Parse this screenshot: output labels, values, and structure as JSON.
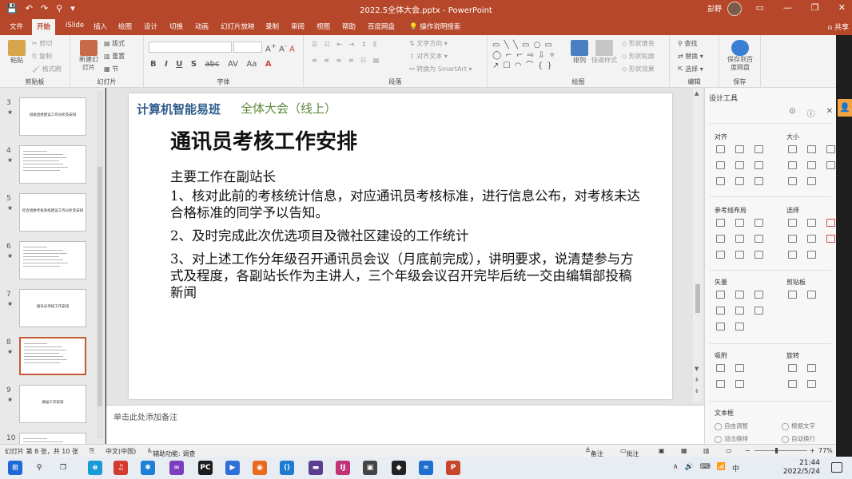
{
  "titlebar": {
    "qat": [
      "💾",
      "↶",
      "↷",
      "⚲",
      "▾"
    ],
    "doc_title": "2022.5全体大会.pptx  -  PowerPoint",
    "user_name": "彭野",
    "window_buttons": [
      "▭",
      "—",
      "❐",
      "✕"
    ]
  },
  "menubar": {
    "tabs": [
      "文件",
      "开始",
      "iSlide",
      "插入",
      "绘图",
      "设计",
      "切换",
      "动画",
      "幻灯片放映",
      "录制",
      "审阅",
      "视图",
      "帮助",
      "百度网盘",
      "操作说明搜索"
    ],
    "active_tab": "开始",
    "share": "共享"
  },
  "ribbon": {
    "clipboard": {
      "paste": "粘贴",
      "cut": "剪切",
      "copy": "复制",
      "format_painter": "格式刷",
      "label": "剪贴板"
    },
    "slides": {
      "new_slide": "新建幻灯片",
      "layout": "版式",
      "reset": "重置",
      "section": "节",
      "label": "幻灯片"
    },
    "font": {
      "bold": "B",
      "italic": "I",
      "underline": "U",
      "shadow": "S",
      "strike": "abc",
      "spacing": "AV",
      "case": "Aa",
      "label": "字体"
    },
    "paragraph": {
      "text_direction": "文字方向",
      "align_text": "对齐文本",
      "smartart": "转换为 SmartArt",
      "label": "段落"
    },
    "drawing": {
      "arrange": "排列",
      "quick_styles": "快速样式",
      "shape_fill": "形状填充",
      "shape_outline": "形状轮廓",
      "shape_effects": "形状效果",
      "label": "绘图"
    },
    "editing": {
      "find": "查找",
      "replace": "替换",
      "select": "选择",
      "label": "编辑"
    },
    "save": {
      "save_to_baidu": "保存到百度网盘",
      "label": "保存"
    }
  },
  "thumbnails": [
    {
      "num": "3",
      "star": "★",
      "text": "班级团委建设工作分析及安排",
      "kind": "title"
    },
    {
      "num": "4",
      "star": "★",
      "text": "",
      "kind": "lines"
    },
    {
      "num": "5",
      "star": "★",
      "text": "综合团委考核系统建设工作分析及安排",
      "kind": "title"
    },
    {
      "num": "6",
      "star": "★",
      "text": "",
      "kind": "lines"
    },
    {
      "num": "7",
      "star": "★",
      "text": "通讯员考核工作安排",
      "kind": "title"
    },
    {
      "num": "8",
      "star": "★",
      "text": "",
      "kind": "lines",
      "active": true
    },
    {
      "num": "9",
      "star": "★",
      "text": "换届工作安排",
      "kind": "title"
    },
    {
      "num": "10",
      "star": "★",
      "text": "",
      "kind": "lines"
    }
  ],
  "slide": {
    "class_name": "计算机智能易班",
    "meeting": "全体大会（线上）",
    "title": "通讯员考核工作安排",
    "lead": "主要工作在副站长",
    "items": [
      "1、核对此前的考核统计信息，对应通讯员考核标准，进行信息公布，对考核未达合格标准的同学予以告知。",
      "2、及时完成此次优选项目及微社区建设的工作统计",
      "3、对上述工作分年级召开通讯员会议（月底前完成），讲明要求，说清楚参与方式及程度，各副站长作为主讲人，三个年级会议召开完毕后统一交由编辑部投稿新闻"
    ]
  },
  "notes_placeholder": "单击此处添加备注",
  "design_pane": {
    "title": "设计工具",
    "sections": [
      "对齐",
      "大小",
      "参考线布局",
      "选择",
      "矢量",
      "剪贴板",
      "吸附",
      "旋转",
      "文本框"
    ],
    "text_options": [
      "自由调整",
      "根据文字",
      "溢出缩排",
      "自动换行"
    ]
  },
  "statusbar": {
    "slide_info": "幻灯片 第 8 张，共 10 张",
    "language": "中文(中国)",
    "accessibility": "辅助功能: 调查",
    "notes": "备注",
    "comments": "批注",
    "zoom": "77%"
  },
  "taskbar": {
    "apps": [
      {
        "name": "windows-start",
        "glyph": "⊞",
        "color": "#1e6ad6"
      },
      {
        "name": "search",
        "glyph": "⚲",
        "color": "#e8edf3"
      },
      {
        "name": "task-view",
        "glyph": "❐",
        "color": "#e8edf3"
      },
      {
        "name": "edge",
        "glyph": "e",
        "color": "#1a9bd6"
      },
      {
        "name": "netease-music",
        "glyph": "♫",
        "color": "#d33a31"
      },
      {
        "name": "app-star",
        "glyph": "✱",
        "color": "#1d7fd6"
      },
      {
        "name": "visual-studio",
        "glyph": "∞",
        "color": "#7b3fbe"
      },
      {
        "name": "pycharm",
        "glyph": "PC",
        "color": "#1b1b1b"
      },
      {
        "name": "app-blue",
        "glyph": "▶",
        "color": "#2f6fd8"
      },
      {
        "name": "firefox",
        "glyph": "◉",
        "color": "#e86b1f"
      },
      {
        "name": "vscode",
        "glyph": "⟨⟩",
        "color": "#1f7bd0"
      },
      {
        "name": "app-bar",
        "glyph": "▬",
        "color": "#5d3d91"
      },
      {
        "name": "intellij",
        "glyph": "IJ",
        "color": "#c0327a"
      },
      {
        "name": "photo",
        "glyph": "▣",
        "color": "#444"
      },
      {
        "name": "app-dark",
        "glyph": "◆",
        "color": "#222"
      },
      {
        "name": "app-wave",
        "glyph": "≈",
        "color": "#1f6fd0"
      },
      {
        "name": "powerpoint",
        "glyph": "P",
        "color": "#c8462a"
      }
    ],
    "time": "21:44",
    "date": "2022/5/24",
    "ime": "中",
    "sys_icons": [
      "∧",
      "🔊",
      "⌨",
      "📶"
    ]
  }
}
